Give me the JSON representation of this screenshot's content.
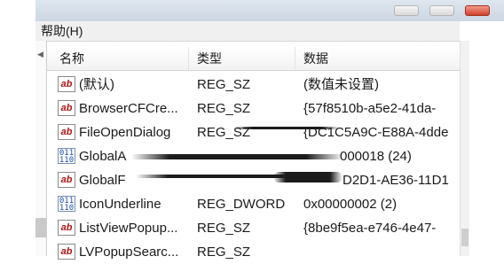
{
  "menu": {
    "help": "帮助(H)"
  },
  "columns": {
    "name": "名称",
    "type": "类型",
    "data": "数据"
  },
  "rows": [
    {
      "icon": "ab",
      "name": "(默认)",
      "type": "REG_SZ",
      "data": "(数值未设置)"
    },
    {
      "icon": "ab",
      "name": "BrowserCFCre...",
      "type": "REG_SZ",
      "data": "{57f8510b-a5e2-41da-"
    },
    {
      "icon": "ab",
      "name": "FileOpenDialog",
      "type": "REG_SZ",
      "data": "{DC1C5A9C-E88A-4dde"
    },
    {
      "icon": "bin",
      "name": "GlobalA",
      "type": "",
      "data": "000018 (24)"
    },
    {
      "icon": "ab",
      "name": "GlobalF",
      "type": "",
      "data": "D2D1-AE36-11D1"
    },
    {
      "icon": "bin",
      "name": "IconUnderline",
      "type": "REG_DWORD",
      "data": "0x00000002 (2)"
    },
    {
      "icon": "ab",
      "name": "ListViewPopup...",
      "type": "REG_SZ",
      "data": "{8be9f5ea-e746-4e47-"
    },
    {
      "icon": "ab",
      "name": "LVPopupSearc...",
      "type": "REG_SZ",
      "data": ""
    }
  ],
  "icons": {
    "string_value": "ab",
    "binary_value": "011\n110"
  }
}
